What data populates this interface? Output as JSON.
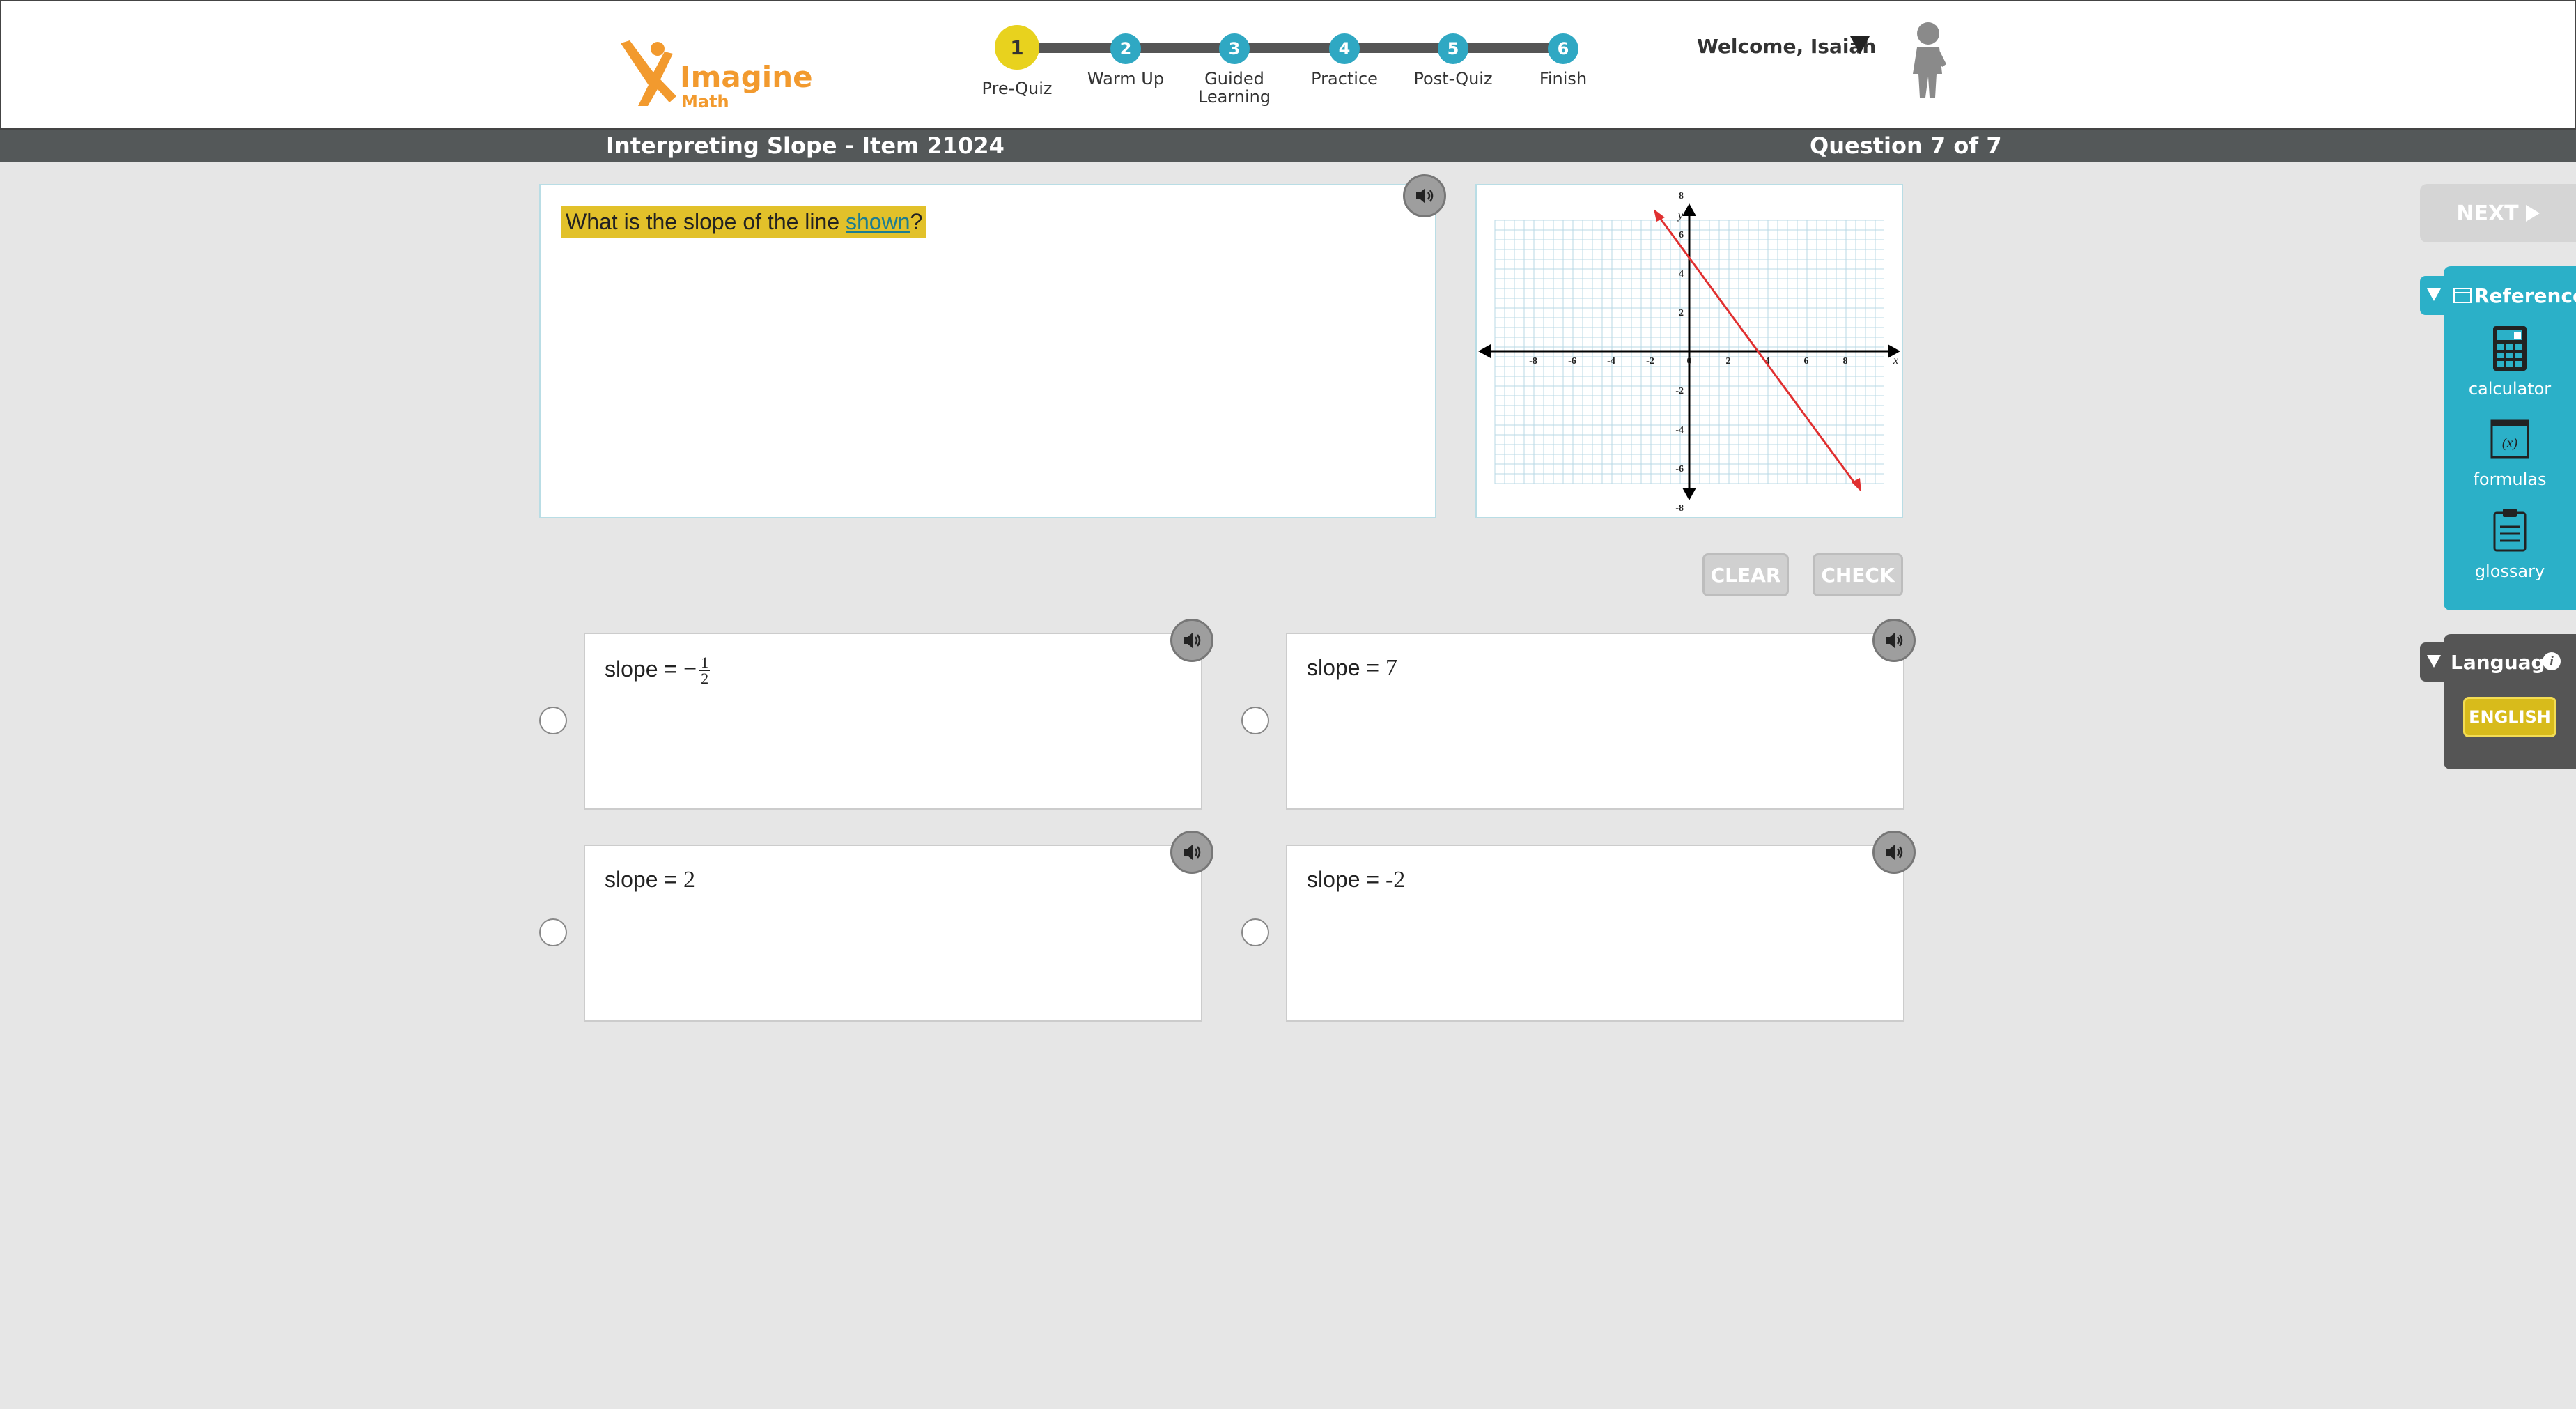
{
  "header": {
    "logo": {
      "brand": "Imagine",
      "sub": "Math"
    },
    "steps": [
      {
        "number": "1",
        "label": "Pre-Quiz",
        "current": true
      },
      {
        "number": "2",
        "label": "Warm Up"
      },
      {
        "number": "3",
        "label": "Guided Learning"
      },
      {
        "number": "4",
        "label": "Practice"
      },
      {
        "number": "5",
        "label": "Post-Quiz"
      },
      {
        "number": "6",
        "label": "Finish"
      }
    ],
    "welcome": "Welcome, Isaiah"
  },
  "titlebar": {
    "title": "Interpreting Slope - Item 21024",
    "question_count": "Question 7 of 7"
  },
  "question": {
    "text_before": "What is the slope of the line ",
    "link_text": "shown",
    "text_after": "?"
  },
  "graph": {
    "x_label": "x",
    "y_label": "y",
    "x_ticks": [
      "-8",
      "-6",
      "-4",
      "-2",
      "0",
      "2",
      "4",
      "6",
      "8"
    ],
    "y_ticks": [
      "8",
      "6",
      "4",
      "2",
      "-2",
      "-4",
      "-6",
      "-8"
    ],
    "line_color": "#e03030"
  },
  "actions": {
    "clear": "CLEAR",
    "check": "CHECK"
  },
  "answers": [
    {
      "prefix": "slope = ",
      "value": "−",
      "frac_num": "1",
      "frac_den": "2"
    },
    {
      "prefix": "slope = ",
      "value": "7"
    },
    {
      "prefix": "slope = ",
      "value": "2"
    },
    {
      "prefix": "slope = ",
      "value": "-2"
    }
  ],
  "sidebar": {
    "next": "NEXT",
    "reference_title": "Reference",
    "reference_items": [
      "calculator",
      "formulas",
      "glossary"
    ],
    "language_title": "Language",
    "language_button": "ENGLISH"
  },
  "colors": {
    "accent_teal": "#2bb0c8",
    "highlight_yellow": "#e2c12a",
    "brand_orange": "#f29a2e",
    "current_step_yellow": "#e8d21e"
  }
}
